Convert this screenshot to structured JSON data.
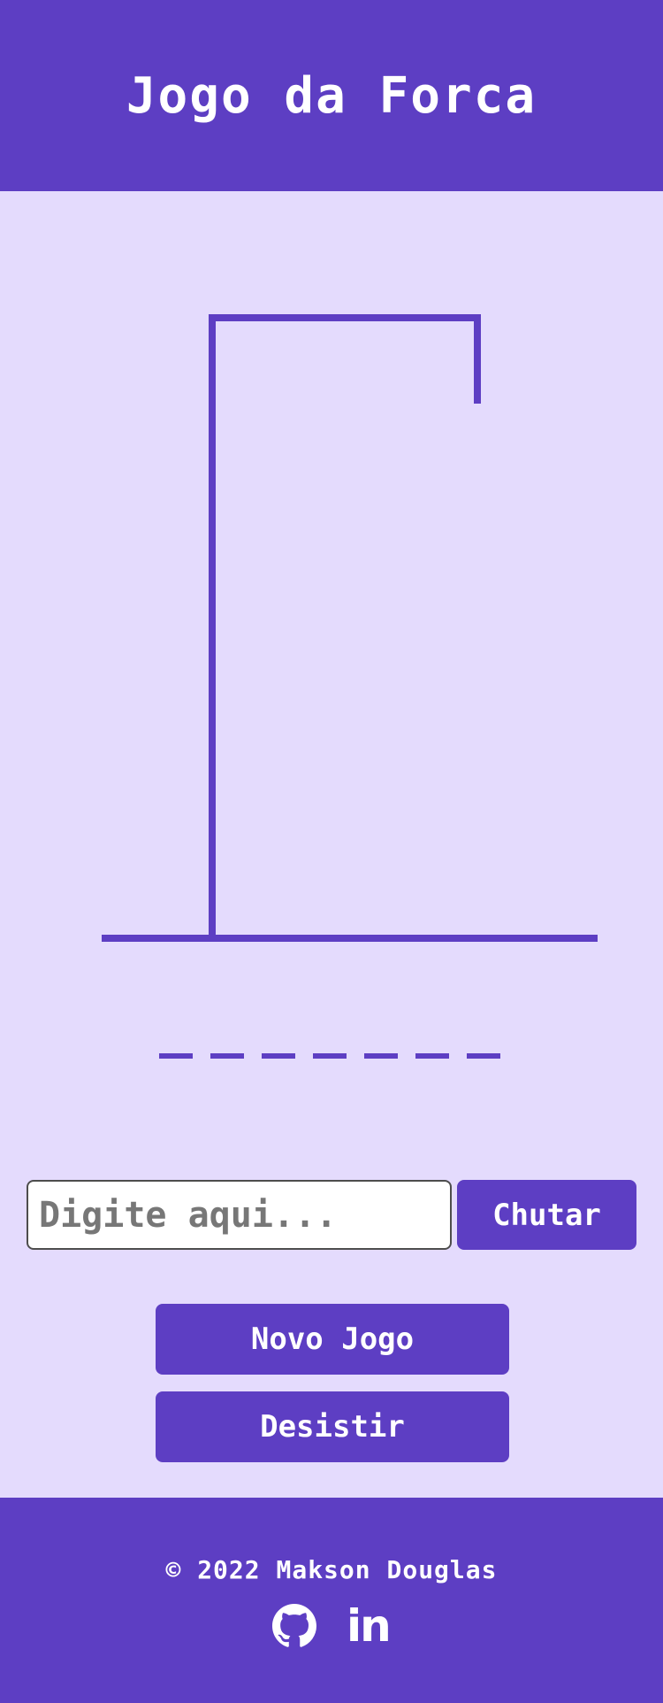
{
  "header": {
    "title": "Jogo da Forca"
  },
  "game": {
    "word_slots": 7,
    "input_placeholder": "Digite aqui...",
    "guess_button": "Chutar",
    "new_game_button": "Novo Jogo",
    "give_up_button": "Desistir"
  },
  "footer": {
    "copyright": "© 2022 Makson Douglas",
    "links": [
      {
        "icon": "github-icon"
      },
      {
        "icon": "linkedin-icon",
        "label": "in"
      }
    ]
  },
  "colors": {
    "primary": "#5d3ec3",
    "background": "#e4dbfd",
    "text_on_primary": "#ffffff"
  }
}
